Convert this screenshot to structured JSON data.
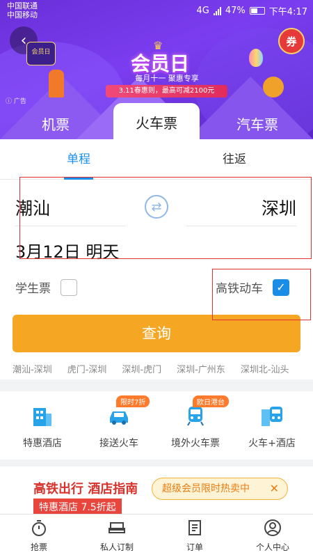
{
  "status_bar": {
    "carrier_1": "中国联通",
    "carrier_2": "中国移动",
    "network": "4G",
    "battery": "47%",
    "time": "下午4:17"
  },
  "banner": {
    "brand_badge": "会员日",
    "title": "会员日",
    "subtitle": "每月十一  聚惠专享",
    "promo": "3.11春惠则，最高可减2100元",
    "ad_tag": "广告",
    "coupon": "券"
  },
  "mode_tabs": [
    "机票",
    "火车票",
    "汽车票"
  ],
  "trip_tabs": [
    "单程",
    "往返"
  ],
  "search": {
    "from_city": "潮汕",
    "to_city": "深圳",
    "swap_symbol": "⇄",
    "date": "3月12日 明天",
    "student_label": "学生票",
    "highspeed_label": "高铁动车",
    "query_label": "查询"
  },
  "history": [
    "潮汕-深圳",
    "虎门-深圳",
    "深圳-虎门",
    "深圳-广州东",
    "深圳北-汕头"
  ],
  "services": [
    {
      "label": "特惠酒店",
      "tag": "",
      "icon": "hotel-building-icon"
    },
    {
      "label": "接送火车",
      "tag": "限时7折",
      "icon": "car-icon"
    },
    {
      "label": "境外火车票",
      "tag": "欧日港台",
      "icon": "train-icon"
    },
    {
      "label": "火车+酒店",
      "tag": "",
      "icon": "train-hotel-icon"
    }
  ],
  "ad": {
    "title": "高铁出行 酒店指南",
    "sub": "特惠酒店 7.5折起",
    "member": "超级会员限时热卖中",
    "close": "✕"
  },
  "bottom_nav": [
    "抢票",
    "私人订制",
    "订单",
    "个人中心"
  ],
  "colors": {
    "accent_blue": "#1a8ee6",
    "query_orange": "#f5a623",
    "banner_purple": "#6a2fd8",
    "annotation_red": "#e03030"
  }
}
